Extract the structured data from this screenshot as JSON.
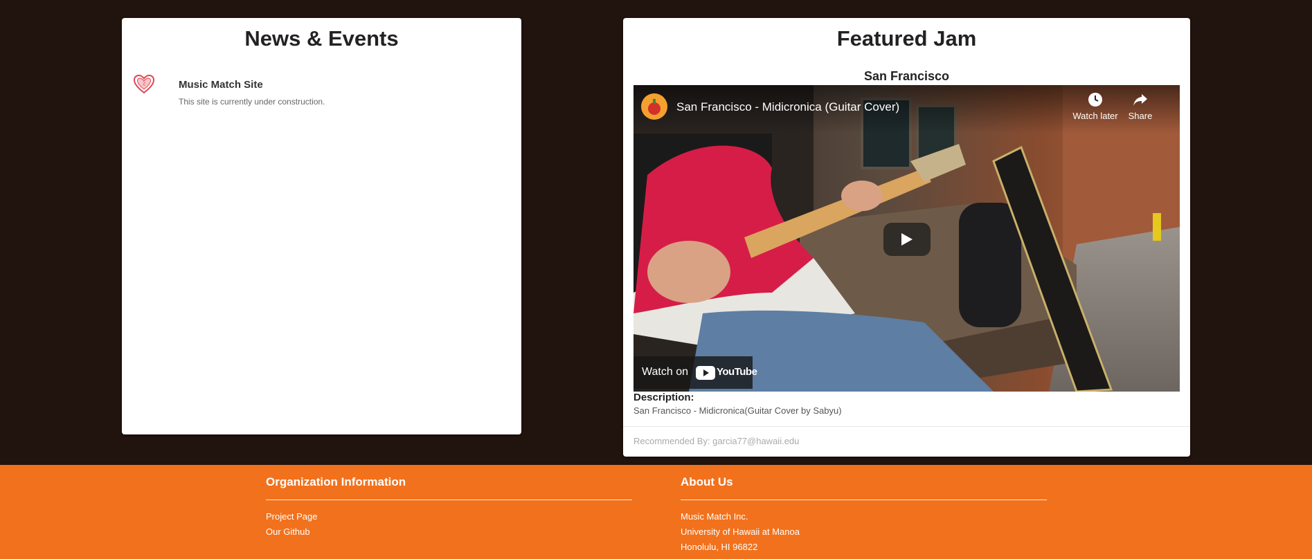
{
  "news": {
    "title": "News & Events",
    "items": [
      {
        "icon": "heart-logo-icon",
        "title": "Music Match Site",
        "text": "This site is currently under construction."
      }
    ]
  },
  "jam": {
    "title": "Featured Jam",
    "song": "San Francisco",
    "video": {
      "title": "San Francisco - Midicronica (Guitar Cover)",
      "watch_later": "Watch later",
      "share": "Share",
      "watch_on": "Watch on",
      "youtube": "YouTube"
    },
    "description_label": "Description:",
    "description": "San Francisco - Midicronica(Guitar Cover by Sabyu)",
    "recommended": "Recommended By: garcia77@hawaii.edu"
  },
  "footer": {
    "org": {
      "heading": "Organization Information",
      "links": [
        "Project Page",
        "Our Github"
      ]
    },
    "about": {
      "heading": "About Us",
      "lines": [
        "Music Match Inc.",
        "University of Hawaii at Manoa",
        "Honolulu, HI 96822"
      ]
    }
  },
  "colors": {
    "page_background": "#21130e",
    "footer_background": "#f2711c",
    "card_background": "#ffffff"
  }
}
